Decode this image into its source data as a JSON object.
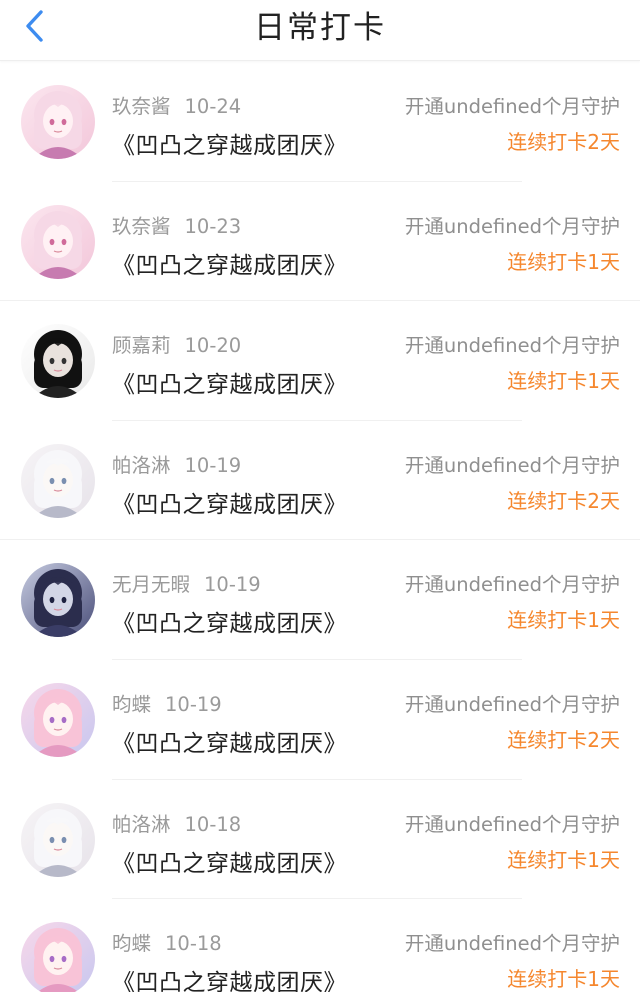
{
  "header": {
    "title": "日常打卡"
  },
  "entries": [
    {
      "name": "玖奈酱",
      "date": "10-24",
      "book": "《凹凸之穿越成团厌》",
      "guard": "开通undefined个月守护",
      "streak": "连续打卡2天",
      "avatar": "pink"
    },
    {
      "name": "玖奈酱",
      "date": "10-23",
      "book": "《凹凸之穿越成团厌》",
      "guard": "开通undefined个月守护",
      "streak": "连续打卡1天",
      "avatar": "pink"
    },
    {
      "name": "顾嘉莉",
      "date": "10-20",
      "book": "《凹凸之穿越成团厌》",
      "guard": "开通undefined个月守护",
      "streak": "连续打卡1天",
      "avatar": "dark"
    },
    {
      "name": "帕洛淋",
      "date": "10-19",
      "book": "《凹凸之穿越成团厌》",
      "guard": "开通undefined个月守护",
      "streak": "连续打卡2天",
      "avatar": "white"
    },
    {
      "name": "无月无暇",
      "date": "10-19",
      "book": "《凹凸之穿越成团厌》",
      "guard": "开通undefined个月守护",
      "streak": "连续打卡1天",
      "avatar": "navy"
    },
    {
      "name": "昀蝶",
      "date": "10-19",
      "book": "《凹凸之穿越成团厌》",
      "guard": "开通undefined个月守护",
      "streak": "连续打卡2天",
      "avatar": "pastel"
    },
    {
      "name": "帕洛淋",
      "date": "10-18",
      "book": "《凹凸之穿越成团厌》",
      "guard": "开通undefined个月守护",
      "streak": "连续打卡1天",
      "avatar": "white"
    },
    {
      "name": "昀蝶",
      "date": "10-18",
      "book": "《凹凸之穿越成团厌》",
      "guard": "开通undefined个月守护",
      "streak": "连续打卡1天",
      "avatar": "pastel"
    }
  ],
  "colors": {
    "back_icon": "#3d8cf0",
    "streak_text": "#f5872e",
    "meta_text": "#9a9a9a",
    "title_text": "#222222"
  }
}
